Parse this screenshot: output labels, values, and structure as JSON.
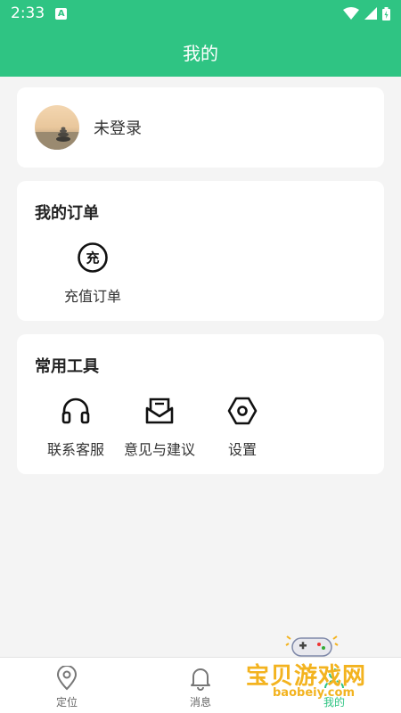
{
  "status": {
    "time": "2:33",
    "a_badge": "A"
  },
  "header": {
    "title": "我的"
  },
  "profile": {
    "name": "未登录"
  },
  "orders": {
    "title": "我的订单",
    "items": [
      {
        "label": "充值订单",
        "icon_char": "充",
        "icon": "recharge-icon"
      }
    ]
  },
  "tools": {
    "title": "常用工具",
    "items": [
      {
        "label": "联系客服",
        "icon": "headset-icon"
      },
      {
        "label": "意见与建议",
        "icon": "feedback-inbox-icon"
      },
      {
        "label": "设置",
        "icon": "settings-hex-icon"
      }
    ]
  },
  "tabs": [
    {
      "label": "定位",
      "icon": "location-icon",
      "active": false
    },
    {
      "label": "消息",
      "icon": "bell-icon",
      "active": false
    },
    {
      "label": "我的",
      "icon": "user-icon",
      "active": true
    }
  ],
  "watermark": {
    "text": "宝贝游戏网",
    "url": "baobeiy.com"
  },
  "colors": {
    "accent": "#2fc483",
    "watermark": "#f3b31f"
  }
}
